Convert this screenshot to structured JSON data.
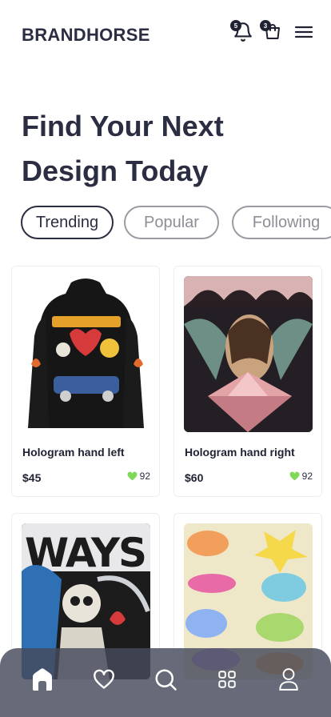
{
  "header": {
    "brand": "BRANDHORSE",
    "notifications_count": "5",
    "cart_count": "3"
  },
  "hero": {
    "line1": "Find Your Next",
    "line2": "Design Today"
  },
  "tabs": [
    {
      "label": "Trending",
      "active": true
    },
    {
      "label": "Popular",
      "active": false
    },
    {
      "label": "Following",
      "active": false
    }
  ],
  "products": [
    {
      "name": "Hologram hand left",
      "price": "$45",
      "likes": "92"
    },
    {
      "name": "Hologram hand right",
      "price": "$60",
      "likes": "92"
    },
    {
      "name": "",
      "price": "",
      "likes": ""
    },
    {
      "name": "",
      "price": "",
      "likes": ""
    }
  ],
  "nav": [
    "home-icon",
    "heart-icon",
    "search-icon",
    "grid-icon",
    "user-icon"
  ],
  "colors": {
    "text": "#2b2d42",
    "like": "#7ed957",
    "nav_bg": "#464a5c"
  }
}
